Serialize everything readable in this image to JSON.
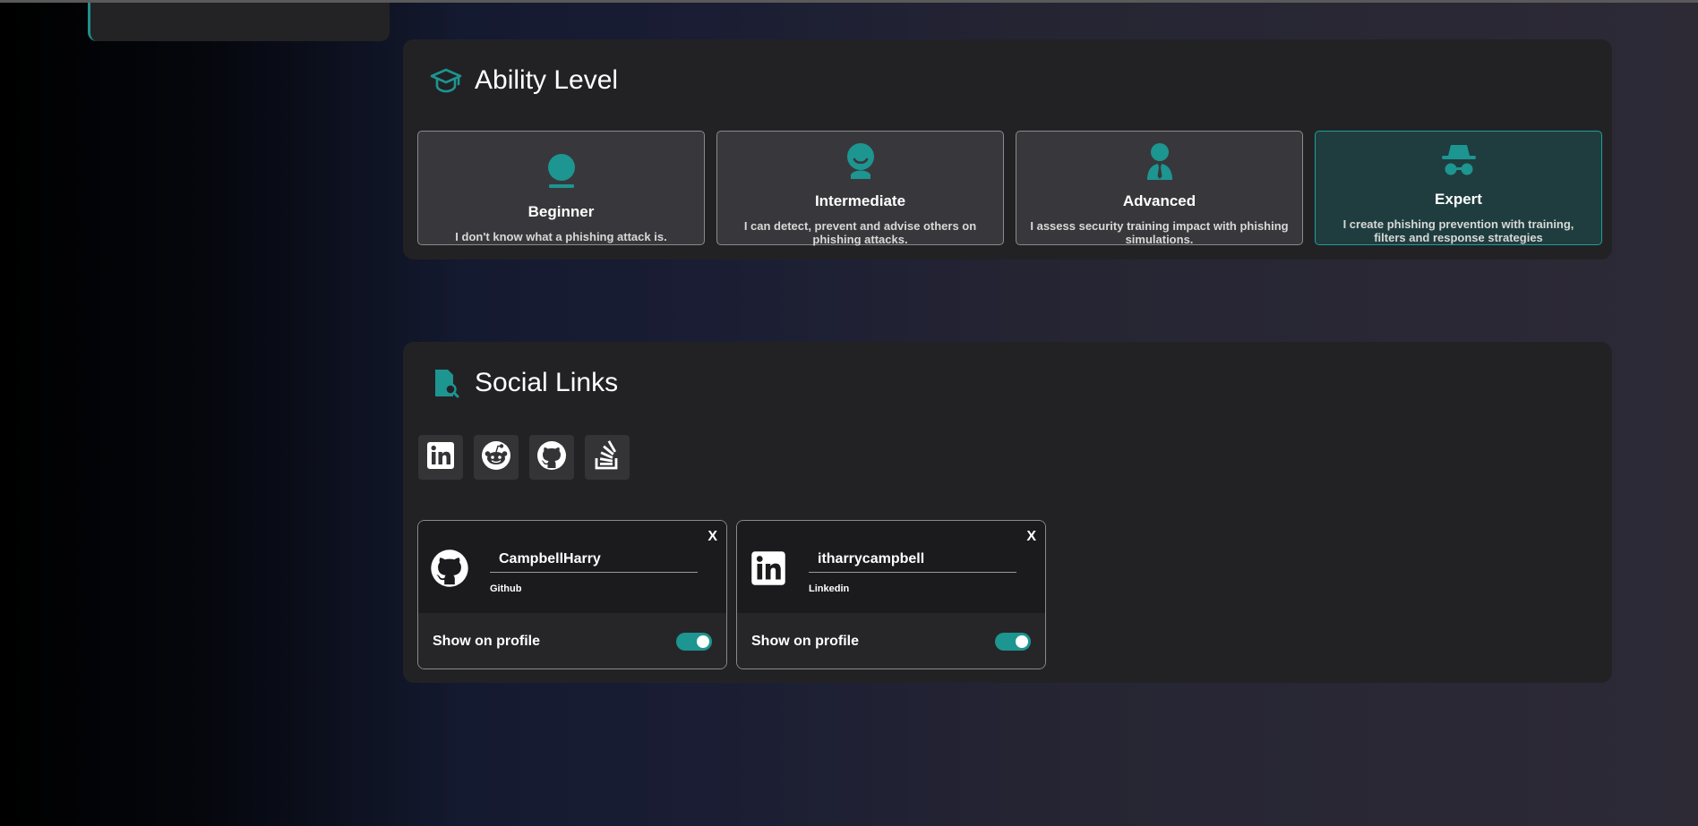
{
  "ability": {
    "title": "Ability Level",
    "levels": [
      {
        "name": "Beginner",
        "description": "I don't know what a phishing attack is.",
        "selected": false
      },
      {
        "name": "Intermediate",
        "description": "I can detect, prevent and advise others on phishing attacks.",
        "selected": false
      },
      {
        "name": "Advanced",
        "description": "I assess security training impact with phishing simulations.",
        "selected": false
      },
      {
        "name": "Expert",
        "description": "I create phishing prevention with training, filters and response strategies",
        "selected": true
      }
    ]
  },
  "social": {
    "title": "Social Links",
    "platform_buttons": [
      {
        "icon": "linkedin-icon"
      },
      {
        "icon": "reddit-icon"
      },
      {
        "icon": "github-icon"
      },
      {
        "icon": "stackoverflow-icon"
      }
    ],
    "links": [
      {
        "icon": "github-icon",
        "handle": "CampbellHarry",
        "platform": "Github",
        "close_label": "X",
        "show_label": "Show on profile",
        "show_on_profile": true
      },
      {
        "icon": "linkedin-icon",
        "handle": "itharrycampbell",
        "platform": "Linkedin",
        "close_label": "X",
        "show_label": "Show on profile",
        "show_on_profile": true
      }
    ]
  },
  "colors": {
    "accent": "#1d9591",
    "selected_bg": "#1f3d3e",
    "panel_bg": "#222225"
  }
}
